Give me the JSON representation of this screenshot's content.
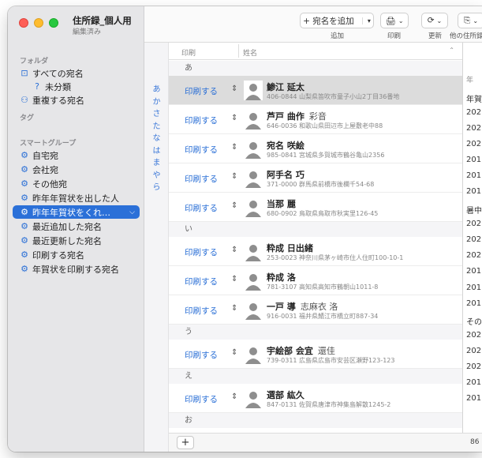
{
  "window": {
    "title": "住所録_個人用",
    "subtitle": "編集済み"
  },
  "sidebar": {
    "folder_heading": "フォルダ",
    "folders": [
      {
        "label": "すべての宛名",
        "icon": "tray-icon"
      },
      {
        "label": "未分類",
        "icon": "question-icon"
      },
      {
        "label": "重複する宛名",
        "icon": "duplicate-person-icon"
      }
    ],
    "tag_heading": "タグ",
    "smart_heading": "スマートグループ",
    "smart_groups": [
      {
        "label": "自宅宛",
        "icon": "gear-icon"
      },
      {
        "label": "会社宛",
        "icon": "gear-icon"
      },
      {
        "label": "その他宛",
        "icon": "gear-icon"
      },
      {
        "label": "昨年年賀状を出した人",
        "icon": "gear-icon"
      },
      {
        "label": "昨年年賀状をくれ…",
        "icon": "gear-icon",
        "selected": true
      },
      {
        "label": "最近追加した宛名",
        "icon": "gear-icon"
      },
      {
        "label": "最近更新した宛名",
        "icon": "gear-icon"
      },
      {
        "label": "印刷する宛名",
        "icon": "gear-icon"
      },
      {
        "label": "年賀状を印刷する宛名",
        "icon": "gear-icon"
      }
    ]
  },
  "toolbar": {
    "add_label": "+ 宛名を追加",
    "add_caption": "追加",
    "print_caption": "印刷",
    "refresh_caption": "更新",
    "other_caption": "他の住所録"
  },
  "index": [
    "あ",
    "か",
    "さ",
    "た",
    "な",
    "は",
    "ま",
    "や",
    "ら"
  ],
  "list": {
    "col_print": "印刷",
    "col_name": "姓名",
    "print_label": "印刷する",
    "sections": [
      {
        "kana": "あ",
        "rows": [
          {
            "name": "鯵江 延太",
            "alt": "",
            "addr": "406-0844 山梨県笛吹市童子小山2丁目36番地",
            "selected": true
          },
          {
            "name": "芦戸 曲作",
            "alt": "彩音",
            "addr": "646-0036 和歌山県田辺市上屋敷老中88"
          },
          {
            "name": "宛名 咲絵",
            "alt": "",
            "addr": "985-0841 宮城県多賀城市鶴谷亀山2356"
          },
          {
            "name": "阿手名 巧",
            "alt": "",
            "addr": "371-0000 群馬県前橋市後欄千54-68"
          },
          {
            "name": "当那 麗",
            "alt": "",
            "addr": "680-0902 鳥取県鳥取市秋実里126-45"
          }
        ]
      },
      {
        "kana": "い",
        "rows": [
          {
            "name": "粋成 日出緒",
            "alt": "",
            "addr": "253-0023 神奈川県茅ヶ崎市住人住町100-10-1"
          },
          {
            "name": "粋成 洛",
            "alt": "",
            "addr": "781-3107 高知県高知市鶴朝山1011-8"
          },
          {
            "name": "一戸 導",
            "alt": "志麻衣 洛",
            "addr": "916-0031 福井県鯖江市橋立町887-34"
          }
        ]
      },
      {
        "kana": "う",
        "rows": [
          {
            "name": "宇絵部 会宜",
            "alt": "還佳",
            "addr": "739-0311 広島県広島市安芸区瀬野123-123"
          }
        ]
      },
      {
        "kana": "え",
        "rows": [
          {
            "name": "選部 紘久",
            "alt": "",
            "addr": "847-0131 佐賀県唐津市神集島解散1245-2"
          }
        ]
      },
      {
        "kana": "お",
        "rows": []
      }
    ]
  },
  "right_col": {
    "header": "年",
    "items": [
      "年賀",
      "202",
      "202",
      "202",
      "201",
      "201",
      "201",
      "暑中",
      "202",
      "202",
      "202",
      "201",
      "201",
      "201",
      "その",
      "202",
      "202",
      "202",
      "201",
      "201"
    ],
    "footer": "86"
  },
  "bottom": {
    "add_label": "+"
  }
}
